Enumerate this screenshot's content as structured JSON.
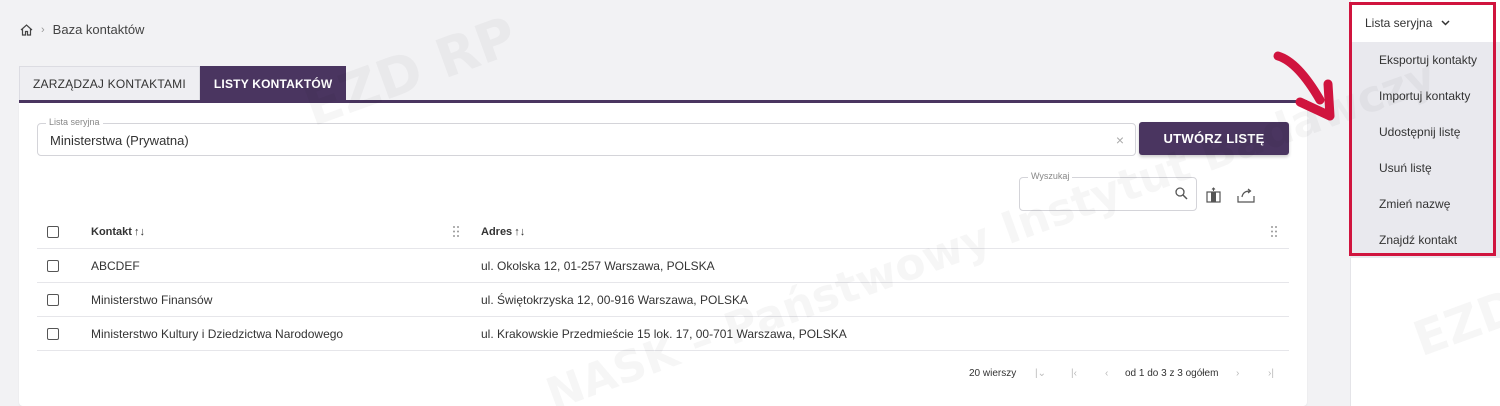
{
  "breadcrumb": {
    "home_icon": "home-icon",
    "current": "Baza kontaktów"
  },
  "tabs": [
    {
      "label": "ZARZĄDZAJ KONTAKTAMI",
      "active": false
    },
    {
      "label": "LISTY KONTAKTÓW",
      "active": true
    }
  ],
  "serial_list": {
    "label": "Lista seryjna",
    "value": "Ministerstwa (Prywatna)",
    "clear_icon": "close-icon"
  },
  "create_button": {
    "label": "UTWÓRZ LISTĘ"
  },
  "search": {
    "label": "Wyszukaj",
    "value": ""
  },
  "table": {
    "columns": [
      {
        "label": "Kontakt",
        "sort_icon": "↑↓"
      },
      {
        "label": "Adres",
        "sort_icon": "↑↓"
      }
    ],
    "rows": [
      {
        "contact": "ABCDEF",
        "address": "ul. Okolska 12, 01-257 Warszawa, POLSKA"
      },
      {
        "contact": "Ministerstwo Finansów",
        "address": "ul. Świętokrzyska 12, 00-916 Warszawa, POLSKA"
      },
      {
        "contact": "Ministerstwo Kultury i Dziedzictwa Narodowego",
        "address": "ul. Krakowskie Przedmieście 15 lok. 17, 00-701 Warszawa, POLSKA"
      }
    ]
  },
  "pagination": {
    "rows_per_page": "20 wierszy",
    "range_text": "od 1 do 3 z 3 ogółem"
  },
  "right_panel": {
    "serial_button": "Lista seryjna",
    "menu": [
      "Eksportuj kontakty",
      "Importuj kontakty",
      "Udostępnij listę",
      "Usuń listę",
      "Zmień nazwę",
      "Znajdź kontakt"
    ]
  },
  "watermark": {
    "lines": [
      "NASK – Państwowy Instytut Badawczy",
      "EZD RP",
      "NASK"
    ]
  },
  "colors": {
    "brand": "#4a3560",
    "highlight": "#d0143e",
    "menu_bg": "#e9e9ee"
  }
}
